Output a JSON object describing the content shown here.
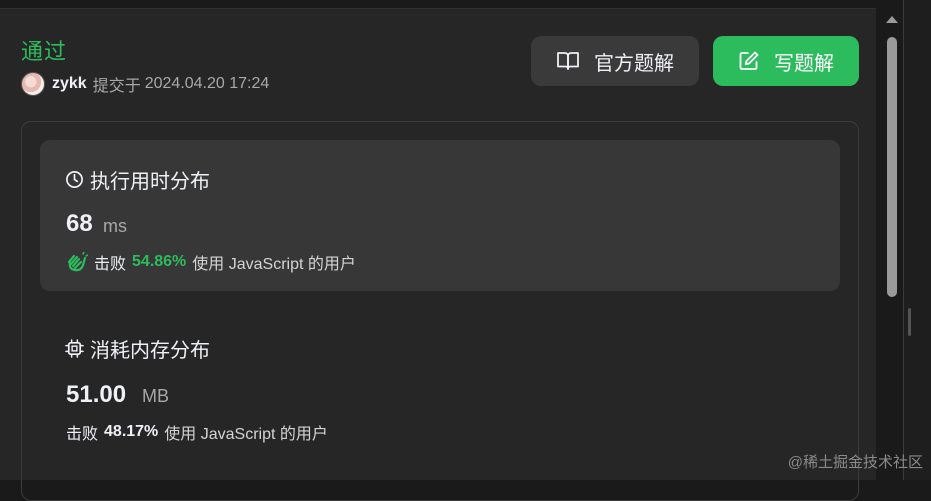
{
  "submission": {
    "status": "通过",
    "username": "zykk",
    "submitted_label": "提交于",
    "datetime": "2024.04.20 17:24"
  },
  "buttons": {
    "official_solution": "官方题解",
    "write_solution": "写题解"
  },
  "runtime": {
    "title": "执行用时分布",
    "value": "68",
    "unit": "ms",
    "beat_label": "击败",
    "beat_percent": "54.86%",
    "beat_suffix": "使用 JavaScript 的用户"
  },
  "memory": {
    "title": "消耗内存分布",
    "value": "51.00",
    "unit": "MB",
    "beat_label": "击败",
    "beat_percent": "48.17%",
    "beat_suffix": "使用 JavaScript 的用户"
  },
  "watermark": "@稀土掘金技术社区",
  "colors": {
    "accent_green": "#2cbb5d",
    "background": "#262626",
    "card_highlight": "#373737"
  },
  "icons": [
    "book-icon",
    "edit-icon",
    "clock-icon",
    "clap-icon",
    "chip-icon",
    "avatar"
  ]
}
